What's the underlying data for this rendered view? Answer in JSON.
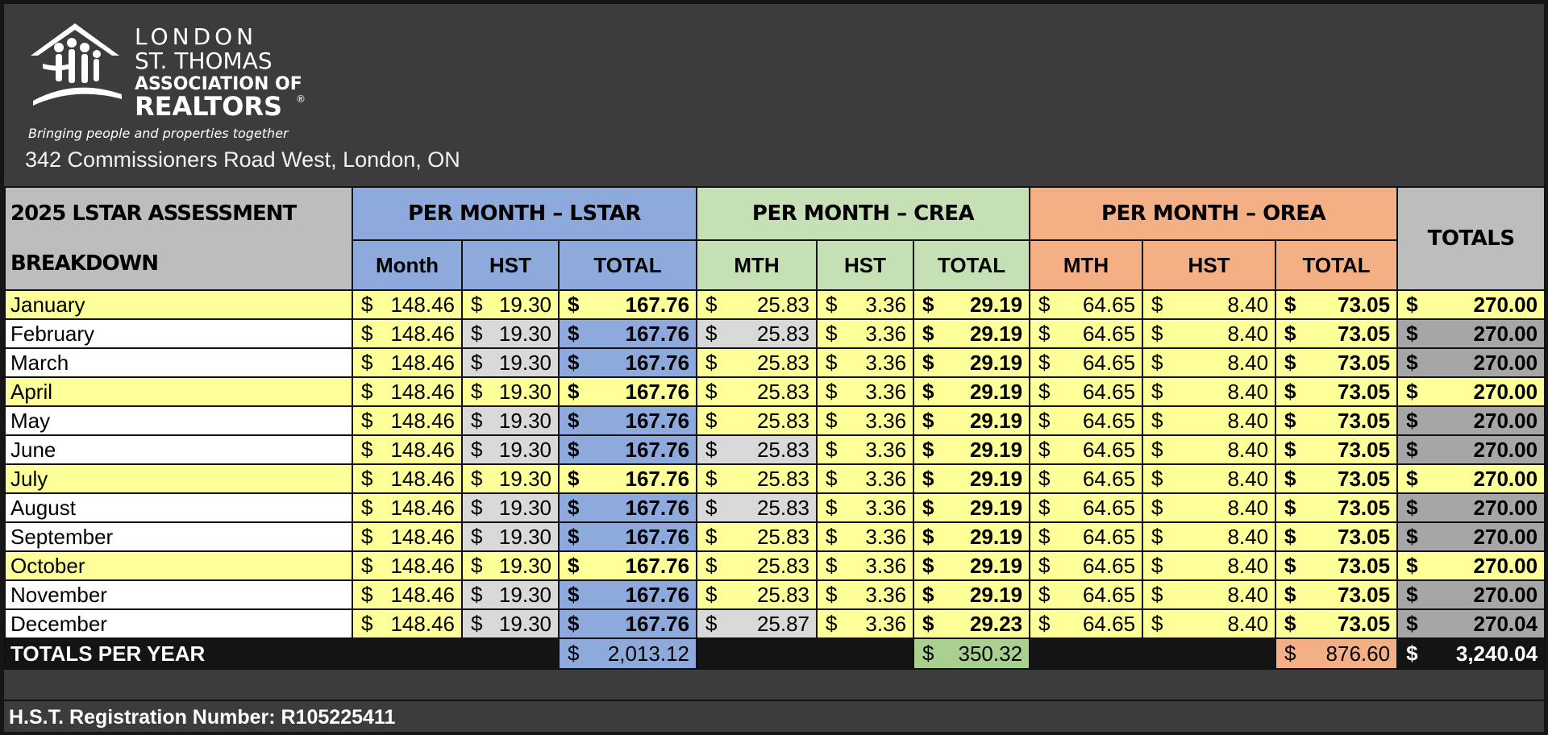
{
  "org": {
    "name_line1": "LONDON",
    "name_line2": "ST. THOMAS",
    "name_line3": "ASSOCIATION OF",
    "name_line4": "REALTORS",
    "registered_mark": "®",
    "tagline": "Bringing people and properties together",
    "address": "342 Commissioners Road West, London, ON"
  },
  "table": {
    "title_line1": "2025 LSTAR ASSESSMENT",
    "title_line2": "BREAKDOWN",
    "groups": {
      "lstar": "PER MONTH – LSTAR",
      "crea": "PER MONTH – CREA",
      "orea": "PER MONTH – OREA",
      "totals": "TOTALS"
    },
    "subheaders": {
      "lstar": [
        "Month",
        "HST",
        "TOTAL"
      ],
      "crea": [
        "MTH",
        "HST",
        "TOTAL"
      ],
      "orea": [
        "MTH",
        "HST",
        "TOTAL"
      ]
    },
    "currency": "$",
    "rows": [
      {
        "month": "January",
        "v": [
          "148.46",
          "19.30",
          "167.76",
          "25.83",
          "3.36",
          "29.19",
          "64.65",
          "8.40",
          "73.05",
          "270.00"
        ]
      },
      {
        "month": "February",
        "v": [
          "148.46",
          "19.30",
          "167.76",
          "25.83",
          "3.36",
          "29.19",
          "64.65",
          "8.40",
          "73.05",
          "270.00"
        ]
      },
      {
        "month": "March",
        "v": [
          "148.46",
          "19.30",
          "167.76",
          "25.83",
          "3.36",
          "29.19",
          "64.65",
          "8.40",
          "73.05",
          "270.00"
        ]
      },
      {
        "month": "April",
        "v": [
          "148.46",
          "19.30",
          "167.76",
          "25.83",
          "3.36",
          "29.19",
          "64.65",
          "8.40",
          "73.05",
          "270.00"
        ]
      },
      {
        "month": "May",
        "v": [
          "148.46",
          "19.30",
          "167.76",
          "25.83",
          "3.36",
          "29.19",
          "64.65",
          "8.40",
          "73.05",
          "270.00"
        ]
      },
      {
        "month": "June",
        "v": [
          "148.46",
          "19.30",
          "167.76",
          "25.83",
          "3.36",
          "29.19",
          "64.65",
          "8.40",
          "73.05",
          "270.00"
        ]
      },
      {
        "month": "July",
        "v": [
          "148.46",
          "19.30",
          "167.76",
          "25.83",
          "3.36",
          "29.19",
          "64.65",
          "8.40",
          "73.05",
          "270.00"
        ]
      },
      {
        "month": "August",
        "v": [
          "148.46",
          "19.30",
          "167.76",
          "25.83",
          "3.36",
          "29.19",
          "64.65",
          "8.40",
          "73.05",
          "270.00"
        ]
      },
      {
        "month": "September",
        "v": [
          "148.46",
          "19.30",
          "167.76",
          "25.83",
          "3.36",
          "29.19",
          "64.65",
          "8.40",
          "73.05",
          "270.00"
        ]
      },
      {
        "month": "October",
        "v": [
          "148.46",
          "19.30",
          "167.76",
          "25.83",
          "3.36",
          "29.19",
          "64.65",
          "8.40",
          "73.05",
          "270.00"
        ]
      },
      {
        "month": "November",
        "v": [
          "148.46",
          "19.30",
          "167.76",
          "25.83",
          "3.36",
          "29.19",
          "64.65",
          "8.40",
          "73.05",
          "270.00"
        ]
      },
      {
        "month": "December",
        "v": [
          "148.46",
          "19.30",
          "167.76",
          "25.87",
          "3.36",
          "29.23",
          "64.65",
          "8.40",
          "73.05",
          "270.04"
        ]
      }
    ],
    "totals_row": {
      "label": "TOTALS PER YEAR",
      "lstar": "2,013.12",
      "crea": "350.32",
      "orea": "876.60",
      "grand": "3,240.04"
    }
  },
  "footer": {
    "hst_registration": "H.S.T. Registration Number: R105225411"
  },
  "colors": {
    "header_bg": "#3c3b3d",
    "lstar": "#8eaadc",
    "crea": "#c5e0b4",
    "orea": "#f4b084",
    "highlight": "#ffff99",
    "light_grey": "#d9d9d9",
    "dark_grey": "#a6a6a6"
  }
}
